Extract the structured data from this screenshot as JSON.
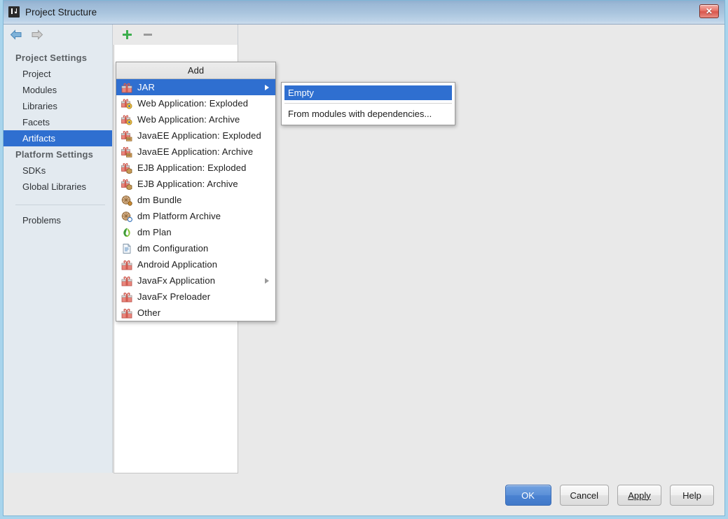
{
  "window": {
    "title": "Project Structure",
    "app_icon": "intellij-idea-icon",
    "close_label": "✕"
  },
  "nav": {
    "back_icon": "arrow-left-icon",
    "forward_icon": "arrow-right-icon"
  },
  "toolbar": {
    "add_icon": "plus-icon",
    "remove_icon": "minus-icon"
  },
  "sidebar": {
    "groups": [
      {
        "label": "Project Settings",
        "items": [
          {
            "label": "Project",
            "selected": false
          },
          {
            "label": "Modules",
            "selected": false
          },
          {
            "label": "Libraries",
            "selected": false
          },
          {
            "label": "Facets",
            "selected": false
          },
          {
            "label": "Artifacts",
            "selected": true
          }
        ]
      },
      {
        "label": "Platform Settings",
        "items": [
          {
            "label": "SDKs",
            "selected": false
          },
          {
            "label": "Global  Libraries",
            "selected": false
          }
        ]
      }
    ],
    "extra_items": [
      {
        "label": "Problems",
        "selected": false
      }
    ]
  },
  "popup": {
    "title": "Add",
    "items": [
      {
        "label": "JAR",
        "icon": "jar-package-icon",
        "selected": true,
        "submenu": true
      },
      {
        "label": "Web  Application:  Exploded",
        "icon": "web-exploded-icon",
        "selected": false,
        "submenu": false
      },
      {
        "label": "Web  Application:  Archive",
        "icon": "web-archive-icon",
        "selected": false,
        "submenu": false
      },
      {
        "label": "JavaEE  Application:  Exploded",
        "icon": "javaee-exploded-icon",
        "selected": false,
        "submenu": false
      },
      {
        "label": "JavaEE  Application:  Archive",
        "icon": "javaee-archive-icon",
        "selected": false,
        "submenu": false
      },
      {
        "label": "EJB  Application:  Exploded",
        "icon": "ejb-exploded-icon",
        "selected": false,
        "submenu": false
      },
      {
        "label": "EJB  Application:  Archive",
        "icon": "ejb-archive-icon",
        "selected": false,
        "submenu": false
      },
      {
        "label": "dm  Bundle",
        "icon": "dm-bundle-icon",
        "selected": false,
        "submenu": false
      },
      {
        "label": "dm  Platform  Archive",
        "icon": "dm-platform-archive-icon",
        "selected": false,
        "submenu": false
      },
      {
        "label": "dm  Plan",
        "icon": "dm-plan-icon",
        "selected": false,
        "submenu": false
      },
      {
        "label": "dm  Configuration",
        "icon": "dm-configuration-icon",
        "selected": false,
        "submenu": false
      },
      {
        "label": "Android  Application",
        "icon": "android-application-icon",
        "selected": false,
        "submenu": false
      },
      {
        "label": "JavaFx  Application",
        "icon": "javafx-application-icon",
        "selected": false,
        "submenu": true
      },
      {
        "label": "JavaFx  Preloader",
        "icon": "javafx-preloader-icon",
        "selected": false,
        "submenu": false
      },
      {
        "label": "Other",
        "icon": "other-package-icon",
        "selected": false,
        "submenu": false
      }
    ]
  },
  "submenu": {
    "items": [
      {
        "label": "Empty",
        "selected": true
      },
      {
        "label": "From  modules  with  dependencies...",
        "selected": false
      }
    ]
  },
  "footer": {
    "buttons": [
      {
        "label": "OK",
        "primary": true,
        "mnemonic": ""
      },
      {
        "label": "Cancel",
        "primary": false,
        "mnemonic": ""
      },
      {
        "label": "Apply",
        "primary": false,
        "mnemonic": "A"
      },
      {
        "label": "Help",
        "primary": false,
        "mnemonic": ""
      }
    ]
  },
  "colors": {
    "accent": "#2f6fd0",
    "titlebar": "#aac5de",
    "sidebar_bg": "#e3eaf0",
    "panel_bg": "#e9e9e9",
    "frame_border": "#a8d4ec",
    "add_green": "#3cae4d"
  }
}
